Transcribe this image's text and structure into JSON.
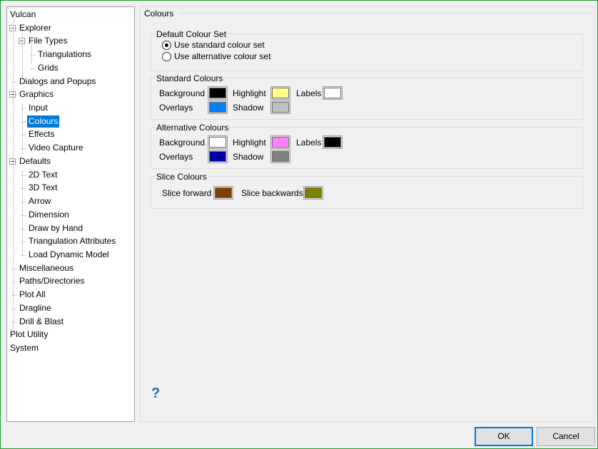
{
  "tree": [
    {
      "label": "Vulcan",
      "level": 0
    },
    {
      "label": "Explorer",
      "level": 1,
      "expander": true
    },
    {
      "label": "File Types",
      "level": 2,
      "expander": true
    },
    {
      "label": "Triangulations",
      "level": 3
    },
    {
      "label": "Grids",
      "level": 3
    },
    {
      "label": "Dialogs and Popups",
      "level": 1
    },
    {
      "label": "Graphics",
      "level": 1,
      "expander": true
    },
    {
      "label": "Input",
      "level": 2
    },
    {
      "label": "Colours",
      "level": 2,
      "selected": true
    },
    {
      "label": "Effects",
      "level": 2
    },
    {
      "label": "Video Capture",
      "level": 2
    },
    {
      "label": "Defaults",
      "level": 1,
      "expander": true
    },
    {
      "label": "2D Text",
      "level": 2
    },
    {
      "label": "3D Text",
      "level": 2
    },
    {
      "label": "Arrow",
      "level": 2
    },
    {
      "label": "Dimension",
      "level": 2
    },
    {
      "label": "Draw by Hand",
      "level": 2
    },
    {
      "label": "Triangulation Attributes",
      "level": 2
    },
    {
      "label": "Load Dynamic Model",
      "level": 2
    },
    {
      "label": "Miscellaneous",
      "level": 1
    },
    {
      "label": "Paths/Directories",
      "level": 1
    },
    {
      "label": "Plot All",
      "level": 1
    },
    {
      "label": "Dragline",
      "level": 1
    },
    {
      "label": "Drill & Blast",
      "level": 1
    },
    {
      "label": "Plot Utility",
      "level": 0
    },
    {
      "label": "System",
      "level": 0
    }
  ],
  "panel": {
    "title": "Colours",
    "default_set": {
      "title": "Default Colour Set",
      "options": [
        "Use standard colour set",
        "Use alternative colour set"
      ],
      "selected": 0
    },
    "standard": {
      "title": "Standard Colours",
      "background": "Background",
      "highlight": "Highlight",
      "labels": "Labels",
      "overlays": "Overlays",
      "shadow": "Shadow",
      "colors": {
        "background": "#000000",
        "highlight": "#ffff80",
        "labels": "#ffffff",
        "overlays": "#0080ff",
        "shadow": "#c0c0c0"
      }
    },
    "alternative": {
      "title": "Alternative Colours",
      "background": "Background",
      "highlight": "Highlight",
      "labels": "Labels",
      "overlays": "Overlays",
      "shadow": "Shadow",
      "colors": {
        "background": "#ffffff",
        "highlight": "#ff80ff",
        "labels": "#000000",
        "overlays": "#0000a0",
        "shadow": "#808080"
      }
    },
    "slice": {
      "title": "Slice Colours",
      "forward": "Slice forward",
      "backwards": "Slice backwards",
      "colors": {
        "forward": "#804000",
        "backwards": "#808000"
      }
    },
    "help": "?"
  },
  "buttons": {
    "ok": "OK",
    "cancel": "Cancel"
  }
}
